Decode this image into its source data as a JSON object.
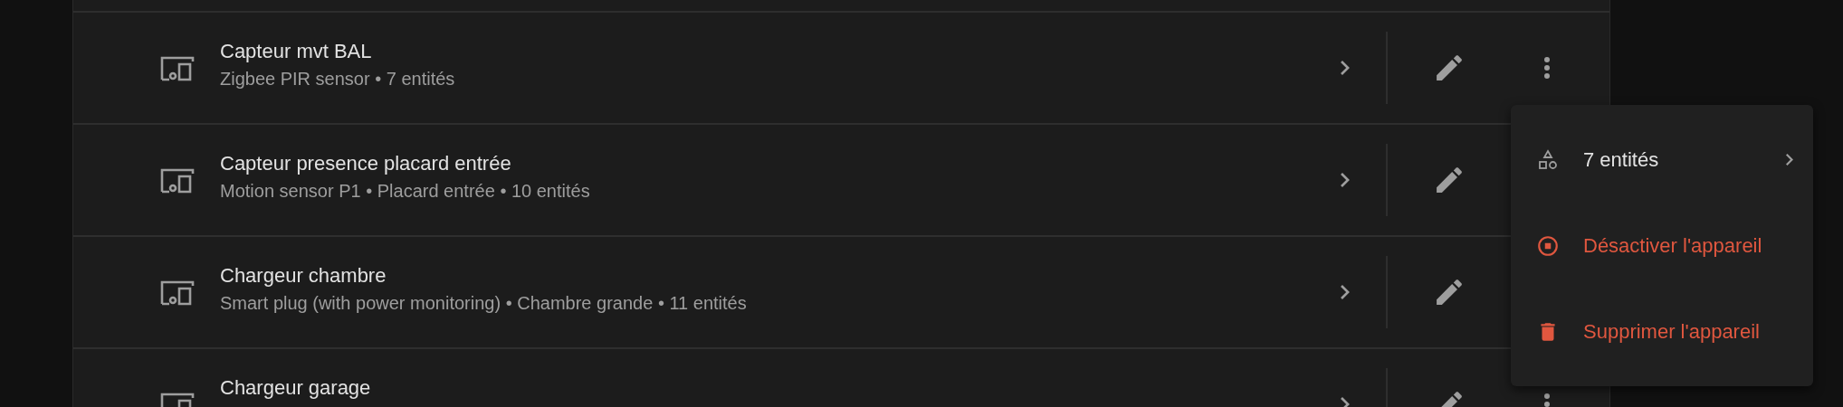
{
  "devices": [
    {
      "name": "Capteur mvt BAL",
      "details": "Zigbee PIR sensor • 7 entités"
    },
    {
      "name": "Capteur presence placard entrée",
      "details": "Motion sensor P1 • Placard entrée • 10 entités"
    },
    {
      "name": "Chargeur chambre",
      "details": "Smart plug (with power monitoring) • Chambre grande • 11 entités"
    },
    {
      "name": "Chargeur garage"
    }
  ],
  "menu": {
    "items": [
      {
        "kind": "entities",
        "label": "7 entités"
      },
      {
        "kind": "disable",
        "label": "Désactiver l'appareil"
      },
      {
        "kind": "delete",
        "label": "Supprimer l'appareil"
      }
    ]
  }
}
